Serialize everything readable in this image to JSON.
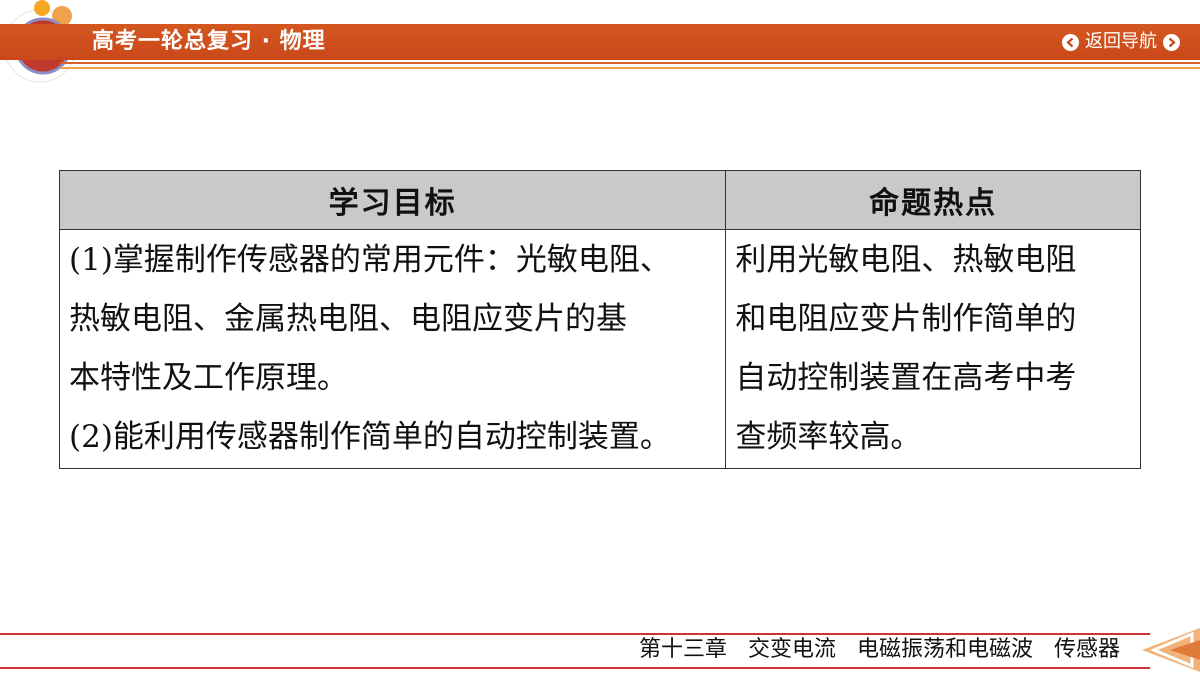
{
  "header": {
    "title": "高考一轮总复习 · 物理",
    "nav_back_label": "返回导航"
  },
  "table": {
    "headers": [
      "学习目标",
      "命题热点"
    ],
    "objectives": "(1)掌握制作传感器的常用元件：光敏电阻、\n热敏电阻、金属热电阻、电阻应变片的基\n本特性及工作原理。\n(2)能利用传感器制作简单的自动控制装置。",
    "hotspots": "利用光敏电阻、热敏电阻\n和电阻应变片制作简单的\n自动控制装置在高考中考\n查频率较高。"
  },
  "footer": {
    "chapter": "第十三章   交变电流   电磁振荡和电磁波   传感器"
  },
  "colors": {
    "header_bar": "#c9481a",
    "accent_orange": "#f0a14b",
    "table_header_bg": "#c9c9c9",
    "footer_line": "#cc3333"
  }
}
